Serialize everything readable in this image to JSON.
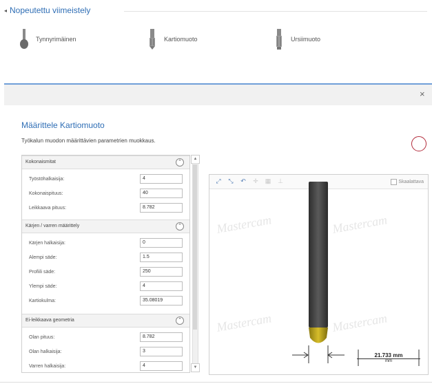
{
  "section": {
    "title": "Nopeutettu viimeistely",
    "tools": [
      {
        "label": "Tynnyrimäinen",
        "icon": "barrel-tool-icon"
      },
      {
        "label": "Kartiomuoto",
        "icon": "taper-tool-icon"
      },
      {
        "label": "Ursiimuoto",
        "icon": "lens-tool-icon"
      }
    ]
  },
  "dialog": {
    "title": "Määrittele Kartiomuoto",
    "description": "Työkalun muodon määrittävien parametrien muokkaus.",
    "close_label": "×"
  },
  "groups": [
    {
      "title": "Kokonaismitat",
      "toggle": "⌃",
      "rows": [
        {
          "label": "Työstöhalkaisija:",
          "value": "4"
        },
        {
          "label": "Kokonaispituus:",
          "value": "40"
        },
        {
          "label": "Leikkaava pituus:",
          "value": "8.782"
        }
      ]
    },
    {
      "title": "Kärjen / varren määrittely",
      "toggle": "⌃",
      "rows": [
        {
          "label": "Kärjen halkaisija:",
          "value": "0"
        },
        {
          "label": "Alempi säde:",
          "value": "1.5"
        },
        {
          "label": "Profiili säde:",
          "value": "250"
        },
        {
          "label": "Ylempi säde:",
          "value": "4"
        },
        {
          "label": "Kartiokulma:",
          "value": "35.08019"
        }
      ]
    },
    {
      "title": "Ei-leikkaava geometria",
      "toggle": "⌃",
      "rows": [
        {
          "label": "Olan pituus:",
          "value": "8.782"
        },
        {
          "label": "Olan halkaisija:",
          "value": "3"
        },
        {
          "label": "Varren halkaisija:",
          "value": "4"
        }
      ]
    }
  ],
  "preview": {
    "checkbox_label": "Skaalattava",
    "watermark": "Mastercam",
    "dimension": "21.733 mm",
    "dimension_sub": "mm",
    "colors": {
      "shank": "#3d3d3d",
      "tip": "#b8a020",
      "circle": "#b22a3a",
      "accent": "#2f6eb5"
    }
  }
}
